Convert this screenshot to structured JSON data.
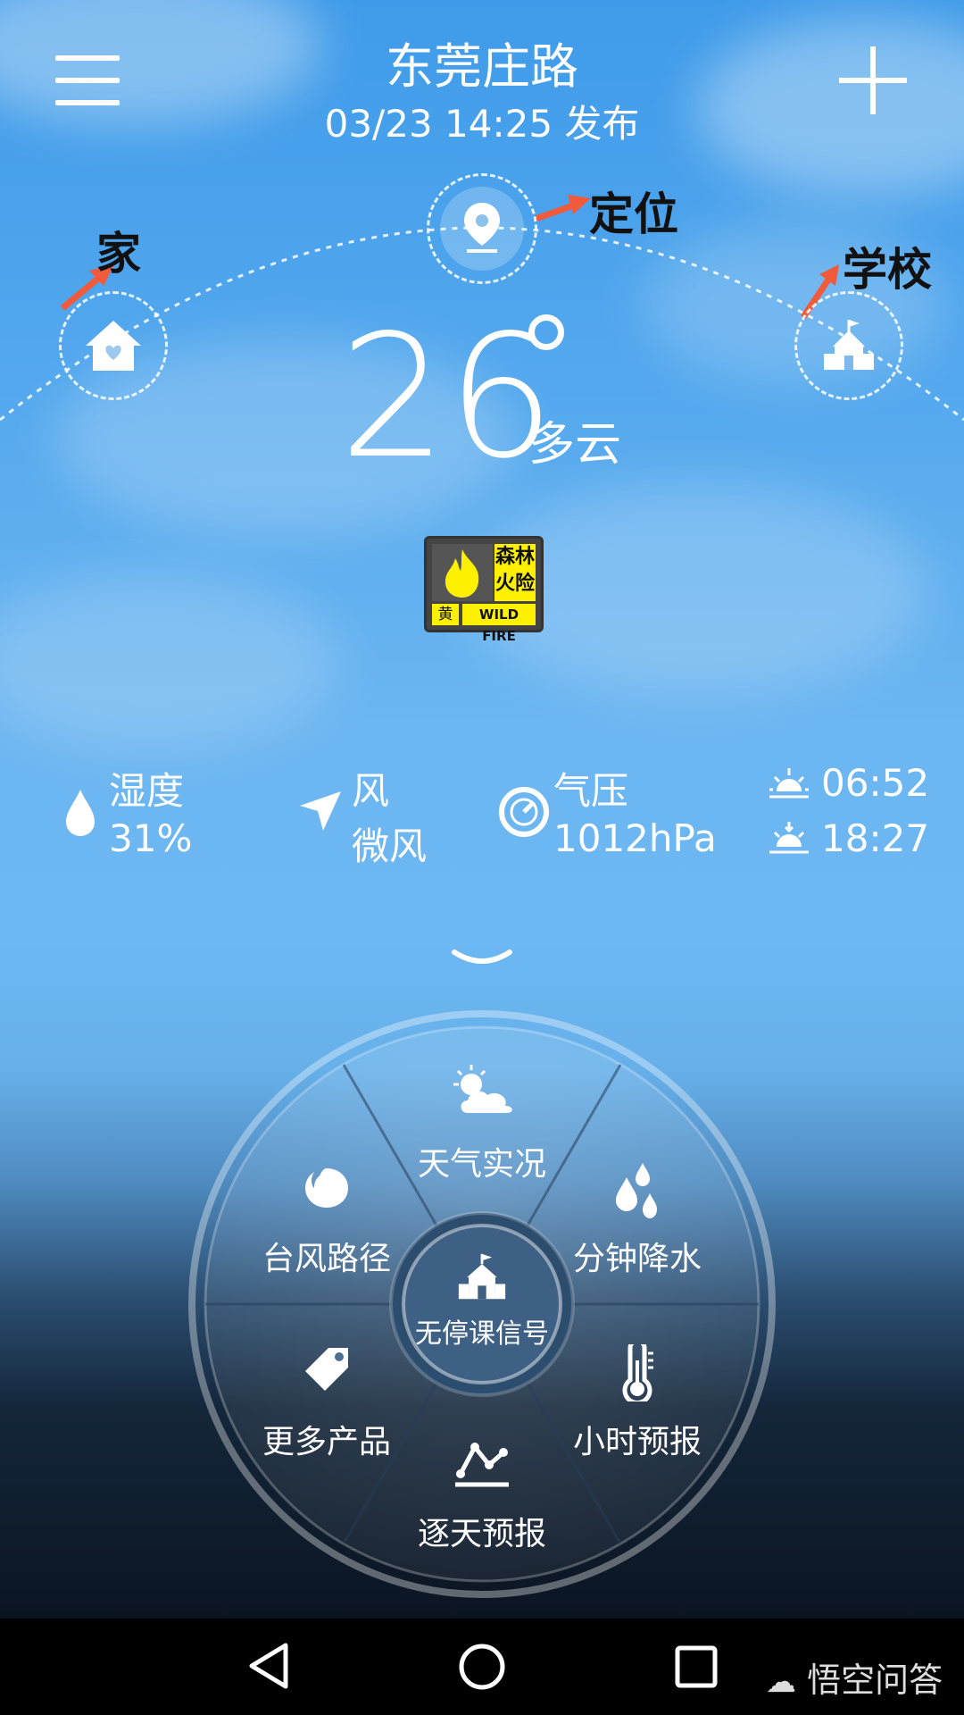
{
  "header": {
    "city": "东莞庄路",
    "publish_time": "03/23  14:25 发布"
  },
  "locations": {
    "home_label": "家",
    "current_label": "定位",
    "school_label": "学校"
  },
  "current": {
    "temperature": "26",
    "condition": "多云"
  },
  "warning": {
    "title_line1": "森林",
    "title_line2": "火险",
    "level": "黄",
    "english": "WILD FIRE"
  },
  "stats": {
    "humidity_label": "湿度",
    "humidity_value": "31%",
    "wind_label": "风",
    "wind_value": "微风",
    "pressure_label": "气压",
    "pressure_value": "1012hPa",
    "sunrise": "06:52",
    "sunset": "18:27"
  },
  "wheel": {
    "center": "无停课信号",
    "top": "天气实况",
    "top_right": "分钟降水",
    "bottom_right": "小时预报",
    "bottom": "逐天预报",
    "bottom_left": "更多产品",
    "top_left": "台风路径"
  },
  "watermark": "悟空问答",
  "colors": {
    "annotation_arrow": "#f15a3a",
    "warning_yellow": "#fdf000"
  }
}
